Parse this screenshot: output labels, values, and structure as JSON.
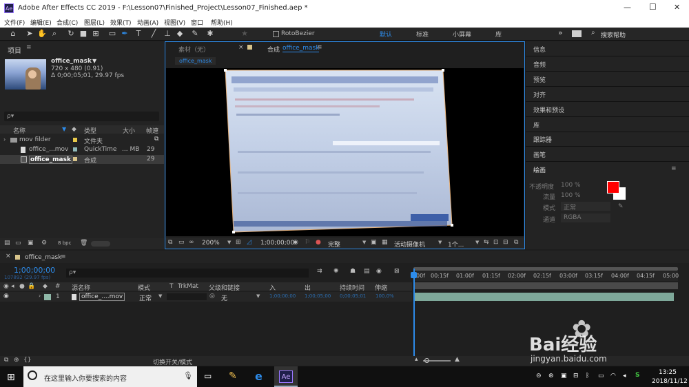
{
  "window": {
    "app_icon": "Ae",
    "title": "Adobe After Effects CC 2019 - F:\\Lesson07\\Finished_Project\\Lesson07_Finished.aep *",
    "minimize": "—",
    "maximize": "☐",
    "close": "✕"
  },
  "menu": [
    "文件(F)",
    "编辑(E)",
    "合成(C)",
    "图层(L)",
    "效果(T)",
    "动画(A)",
    "视图(V)",
    "窗口",
    "帮助(H)"
  ],
  "toolbar": {
    "roto_label": "RotoBezier",
    "workspaces": [
      "默认",
      "标准",
      "小屏幕",
      "库"
    ],
    "active_workspace": "默认",
    "more": "»",
    "search_placeholder": "搜索帮助"
  },
  "project": {
    "title": "项目",
    "item_name": "office_mask",
    "item_dims": "720 x 480 (0.91)",
    "item_duration": "Δ 0;00;05;01, 29.97 fps",
    "search_placeholder": "ρ▾",
    "columns": {
      "name": "名称",
      "type": "类型",
      "size": "大小",
      "frame": "帧速"
    },
    "rows": [
      {
        "name": "mov filder",
        "type": "文件夹",
        "size": "",
        "fps": "",
        "color": "#e8c94a"
      },
      {
        "name": "office_...mov",
        "type": "QuickTime",
        "size": "... MB",
        "fps": "29",
        "color": "#8fb8b8"
      },
      {
        "name": "office_mask",
        "type": "合成",
        "size": "",
        "fps": "29",
        "color": "#d8c48a"
      }
    ],
    "bpc": "8 bpc"
  },
  "viewer": {
    "tab_footage": "素材（无）",
    "tab_comp_prefix": "合成",
    "tab_comp_name": "office_mask",
    "comp_chip": "office_mask",
    "zoom": "200%",
    "timecode": "1;00;00;00",
    "quality": "完整",
    "camera": "活动摄像机",
    "views": "1个..."
  },
  "right_panels": [
    "信息",
    "音频",
    "预览",
    "对齐",
    "效果和预设",
    "库",
    "跟踪器",
    "画笔",
    "绘画"
  ],
  "paint": {
    "opacity_label": "不透明度",
    "opacity_value": "100 %",
    "flow_label": "流量",
    "flow_value": "100 %",
    "mode_label": "模式",
    "mode_value": "正常",
    "channel_label": "通道",
    "channel_value": "RGBA",
    "fg_color": "#ff0000",
    "bg_color": "#ffffff"
  },
  "timeline": {
    "tab": "office_mask",
    "timecode": "1;00;00;00",
    "frames": "107892 (29.97 fps)",
    "search_placeholder": "ρ▾",
    "columns": {
      "num": "#",
      "source": "源名称",
      "mode": "模式",
      "t": "T",
      "trkmat": "TrkMat",
      "parent": "父级和链接",
      "in": "入",
      "out": "出",
      "duration": "持续时间",
      "stretch": "伸缩"
    },
    "layer": {
      "index": "1",
      "name": "office_....mov",
      "mode": "正常",
      "parent": "无",
      "in": "1;00;00;00",
      "out": "1;00;05;00",
      "duration": "0;00;05;01",
      "stretch": "100.0%"
    },
    "ruler": [
      "00f",
      "00:15f",
      "01:00f",
      "01:15f",
      "02:00f",
      "02:15f",
      "03:00f",
      "03:15f",
      "04:00f",
      "04:15f",
      "05:00"
    ],
    "toggle_label": "切换开关/模式"
  },
  "taskbar": {
    "search_placeholder": "在这里输入你要搜索的内容",
    "time": "13:25",
    "date": "2018/11/12",
    "ae_label": "Ae"
  },
  "watermark": {
    "brand": "Bai经验",
    "url": "jingyan.baidu.com"
  },
  "colors": {
    "accent": "#2d8ceb",
    "layer_bar": "#7ea89a",
    "panel": "#232323"
  }
}
